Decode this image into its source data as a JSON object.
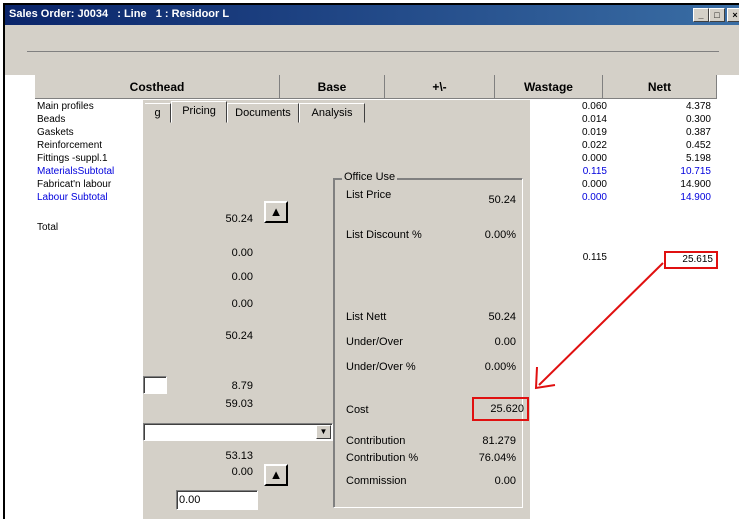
{
  "window": {
    "title": "Sales Order: J0034   : Line   1 : Residoor L",
    "minimize": "_",
    "maximize": "□",
    "close": "×"
  },
  "grid": {
    "headers": [
      "Costhead",
      "Base",
      "+\\-",
      "Wastage",
      "Nett"
    ],
    "rows": [
      {
        "label": "Main profiles",
        "wastage": "0.060",
        "nett": "4.378"
      },
      {
        "label": "Beads",
        "wastage": "0.014",
        "nett": "0.300"
      },
      {
        "label": "Gaskets",
        "wastage": "0.019",
        "nett": "0.387"
      },
      {
        "label": "Reinforcement",
        "wastage": "0.022",
        "nett": "0.452"
      },
      {
        "label": "Fittings -suppl.1",
        "wastage": "0.000",
        "nett": "5.198"
      },
      {
        "label": "MaterialsSubtotal",
        "wastage": "0.115",
        "nett": "10.715"
      },
      {
        "label": "Fabricat'n labour",
        "wastage": "0.000",
        "nett": "14.900"
      },
      {
        "label": "Labour Subtotal",
        "wastage": "0.000",
        "nett": "14.900"
      }
    ],
    "total": {
      "label": "Total",
      "wastage": "0.115",
      "nett": "25.615"
    }
  },
  "tabs": [
    "g",
    "Pricing",
    "Documents",
    "Analysis"
  ],
  "left_values": [
    "50.24",
    "0.00",
    "0.00",
    "0.00",
    "50.24",
    "8.79",
    "59.03",
    "53.13",
    "0.00"
  ],
  "left_input": "0.00",
  "office_use": {
    "title": "Office Use",
    "rows": [
      {
        "label": "List Price",
        "value": "50.24"
      },
      {
        "label": "List Discount %",
        "value": "0.00%"
      },
      {
        "label": "List Nett",
        "value": "50.24"
      },
      {
        "label": "Under/Over",
        "value": "0.00"
      },
      {
        "label": "Under/Over %",
        "value": "0.00%"
      },
      {
        "label": "Cost",
        "value": "25.620"
      },
      {
        "label": "Contribution",
        "value": "81.279"
      },
      {
        "label": "Contribution %",
        "value": "76.04%"
      },
      {
        "label": "Commission",
        "value": "0.00"
      }
    ]
  },
  "colors": {
    "title_bar": "#0a246a",
    "subtotal_text": "#0000dd",
    "highlight": "#e01010"
  },
  "icons": [
    "up-arrow-icon",
    "dropdown-arrow-icon",
    "minimize-icon",
    "maximize-icon",
    "close-icon"
  ]
}
